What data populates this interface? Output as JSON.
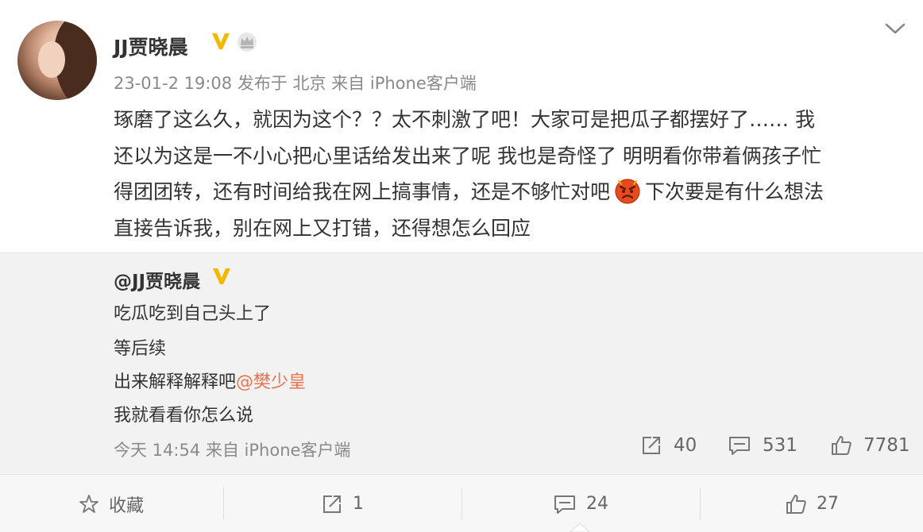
{
  "post": {
    "username": "JJ贾晓晨",
    "meta": "23-01-2 19:08 发布于 北京 来自 iPhone客户端",
    "text_lines": [
      "琢磨了这么久，就因为这个？？太不刺激了吧！大家可是把瓜子都摆好了…… 我",
      "还以为这是一不小心把心里话给发出来了呢 我也是奇怪了 明明看你带着俩孩子忙",
      "得团团转，还有时间给我在网上搞事情，还是不够忙对吧",
      "下次要是有什么想法",
      "直接告诉我，别在网上又打错，还得想怎么回应"
    ],
    "icons": {
      "verified": "verified-v-icon",
      "member": "crown-icon",
      "menu": "chevron-down-icon",
      "emoji": "angry-face-emoji"
    }
  },
  "repost": {
    "username": "@JJ贾晓晨",
    "lines": [
      "吃瓜吃到自己头上了",
      "等后续",
      "出来解释解释吧",
      "我就看看你怎么说"
    ],
    "mention": "@樊少皇",
    "meta": "今天 14:54 来自 iPhone客户端",
    "stats": {
      "reposts": "40",
      "comments": "531",
      "likes": "7781"
    }
  },
  "actions": {
    "favorite": "收藏",
    "repost": "1",
    "comment": "24",
    "like": "27"
  },
  "colors": {
    "mention": "#eb7350",
    "verified": "#f5b800",
    "muted": "#8a8a8a",
    "repost_bg": "#f2f2f2"
  }
}
